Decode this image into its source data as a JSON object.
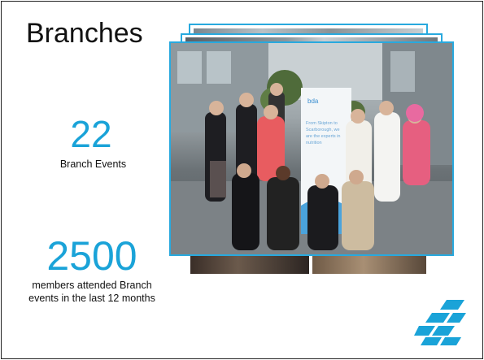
{
  "slide": {
    "title": "Branches",
    "stat1": {
      "number": "22",
      "label": "Branch Events"
    },
    "stat2": {
      "number": "2500",
      "label_line1": "members attended Branch",
      "label_line2": "events in the last 12 months"
    },
    "banner": {
      "brand": "bda",
      "line1": "From Skipton to",
      "line2": "Scarborough, we",
      "line3": "are the experts in",
      "line4": "nutrition"
    }
  },
  "colors": {
    "accent": "#1aa3d8",
    "frame": "#28a9de",
    "text": "#111111"
  },
  "icons": {
    "logo": "bda-logo-icon"
  }
}
